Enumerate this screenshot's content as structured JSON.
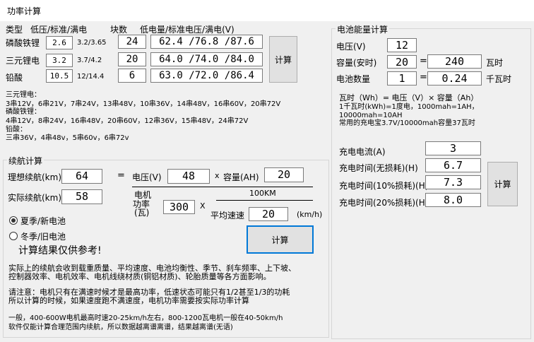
{
  "window": {
    "title": "功率计算"
  },
  "battery_table": {
    "header_type": "类型",
    "header_volt": "低压/标准/满电",
    "header_count": "块数",
    "header_result": "低电量/标准电压/满电(V)",
    "rows": [
      {
        "name": "磷酸铁锂",
        "unit_value": "2.6",
        "range": "3.2/3.65",
        "count": "24",
        "result": "62.4 /76.8 /87.6"
      },
      {
        "name": "三元锂电",
        "unit_value": "3.2",
        "range": "3.7/4.2",
        "count": "20",
        "result": "64.0 /74.0 /84.0"
      },
      {
        "name": "铅酸",
        "unit_value": "10.5",
        "range": "12/14.4",
        "count": "6",
        "result": "63.0 /72.0 /86.4"
      }
    ],
    "calc_label": "计算"
  },
  "reference": {
    "lines": [
      "三元锂电：",
      "3串12V，6串21V，7串24V，13串48V，10串36V，14串48V，16串60V，20串72V",
      "磷酸铁锂：",
      "4串12V，8串24V，16串48V，20串60V，12串36V，15串48V，24串72V",
      "铅酸：",
      "三串36V，4串48v，5串60v，6串72v"
    ]
  },
  "range_calc": {
    "group_title": "续航计算",
    "ideal_label": "理想续航(km)",
    "ideal_value": "64",
    "actual_label": "实际续航(km)",
    "actual_value": "58",
    "eq": "=",
    "voltage_label": "电压(V)",
    "voltage_value": "48",
    "times": "x",
    "capacity_label": "容量(AH)",
    "capacity_value": "20",
    "motor_label_1": "电机",
    "motor_label_2": "功率",
    "motor_label_3": "(瓦)",
    "motor_value": "300",
    "times2": "X",
    "km_label": "100KM",
    "speed_label": "平均速速",
    "speed_value": "20",
    "speed_unit": "(km/h)",
    "summer_label": "夏季/新电池",
    "winter_label": "冬季/旧电池",
    "calc_label": "计算",
    "disclaimer": "计算结果仅供参考!",
    "note_1_a": "实际上的续航会收到载重质量、平均速度、电池均衡性、季节、刹车频率、上下坡、",
    "note_1_b": "控制器效率、电机效率、电机线绕材质(铜铝材质)、轮胎质量等各方面影响。",
    "note_2_a": "请注意：电机只有在满速时候才是最高功率，低速状态可能只有1/2甚至1/3的功耗",
    "note_2_b": "所以计算的时候，如果速度跑不满速度，电机功率需要按实际功率计算",
    "note_3_a": "一般，400-600W电机最高时速20-25km/h左右，800-1200瓦电机一般在40-50km/h",
    "note_3_b": "软件仅能计算合理范围内续航，所以数据越离谱离谱，结果越离谱(无语)"
  },
  "energy_calc": {
    "group_title": "电池能量计算",
    "voltage_label": "电压(V)",
    "voltage_value": "12",
    "capacity_label": "容量(安时)",
    "capacity_value": "20",
    "eq": "=",
    "wh_value": "240",
    "wh_unit": "瓦时",
    "count_label": "电池数量",
    "count_value": "1",
    "kwh_value": "0.24",
    "kwh_unit": "千瓦时",
    "info_1": "瓦时（Wh）= 电压（V）× 容量（Ah）",
    "info_2": "1千瓦时(kWh)=1度电，1000mah=1AH，",
    "info_3": "10000mah=10AH",
    "info_4": "常用的充电宝3.7V/10000mah容量37瓦时"
  },
  "charge_calc": {
    "current_label": "充电电流(A)",
    "current_value": "3",
    "time_nl_label": "充电时间(无损耗)(H)",
    "time_nl_value": "6.7",
    "time_10_label": "充电时间(10%损耗)(H)",
    "time_10_value": "7.3",
    "time_20_label": "充电时间(20%损耗)(H)",
    "time_20_value": "8.0",
    "calc_label": "计算"
  }
}
